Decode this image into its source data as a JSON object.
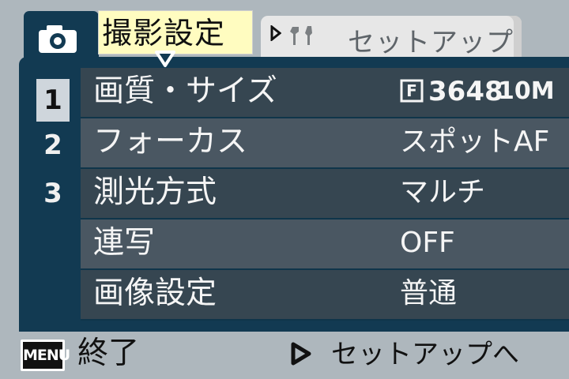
{
  "tabs": {
    "shoot": {
      "icon": "camera-icon",
      "label": "撮影設定"
    },
    "setup": {
      "icon": "wrench-screwdriver-icon",
      "label": "セットアップ"
    }
  },
  "pages": [
    "1",
    "2",
    "3"
  ],
  "menu": [
    {
      "label": "画質・サイズ",
      "value_icon": "fine-quality-icon",
      "value_icon_text": "F",
      "value_primary": "3648",
      "value_secondary": "10M"
    },
    {
      "label": "フォーカス",
      "value": "スポットAF"
    },
    {
      "label": "測光方式",
      "value": "マルチ"
    },
    {
      "label": "連写",
      "value": "OFF"
    },
    {
      "label": "画像設定",
      "value": "普通"
    }
  ],
  "footer": {
    "menu_button": "MENU",
    "exit_label": "終了",
    "next_label": "セットアップへ"
  },
  "colors": {
    "background": "#aeb7bd",
    "panel": "#123a52",
    "selected_tab": "#fffcc0",
    "row_dark": "#364651",
    "row_light": "#4a5762"
  }
}
